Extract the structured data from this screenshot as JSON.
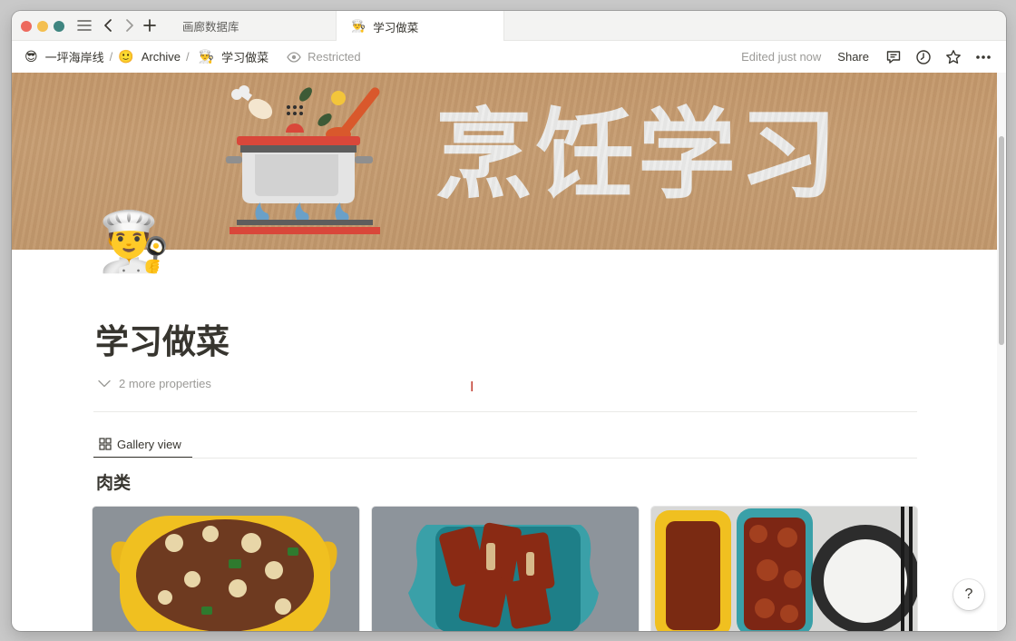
{
  "tabs": [
    {
      "label": "画廊数据库",
      "active": false
    },
    {
      "label": "学习做菜",
      "icon": "👨‍🍳",
      "active": true
    }
  ],
  "breadcrumb": [
    {
      "icon": "😎",
      "label": "一坪海岸线"
    },
    {
      "icon": "🙂",
      "label": "Archive"
    },
    {
      "icon": "👨‍🍳",
      "label": "学习做菜"
    }
  ],
  "restricted_label": "Restricted",
  "topbar": {
    "edited": "Edited just now",
    "share": "Share"
  },
  "cover": {
    "text": "烹饪学习"
  },
  "page": {
    "icon": "👨‍🍳",
    "title": "学习做菜",
    "more_properties": "2 more properties"
  },
  "view": {
    "label": "Gallery view"
  },
  "group": {
    "title": "肉类"
  },
  "help_label": "?",
  "colors": {
    "accent": "#37352f",
    "cover": "#c69d72",
    "muted": "#9b9a97"
  }
}
